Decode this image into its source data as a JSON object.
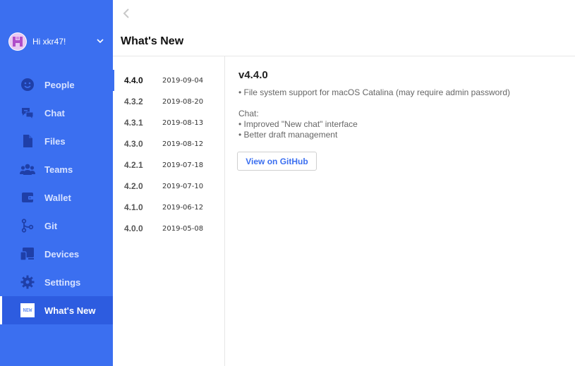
{
  "user": {
    "greeting": "Hi xkr47!"
  },
  "nav": {
    "items": [
      {
        "label": "People",
        "icon": "smiley-icon"
      },
      {
        "label": "Chat",
        "icon": "chat-bubbles-icon"
      },
      {
        "label": "Files",
        "icon": "file-icon"
      },
      {
        "label": "Teams",
        "icon": "team-icon"
      },
      {
        "label": "Wallet",
        "icon": "wallet-icon"
      },
      {
        "label": "Git",
        "icon": "git-branch-icon"
      },
      {
        "label": "Devices",
        "icon": "devices-icon"
      },
      {
        "label": "Settings",
        "icon": "gear-icon"
      },
      {
        "label": "What's New",
        "icon": "new-badge-icon",
        "badge": "NEW",
        "active": true
      }
    ]
  },
  "header": {
    "title": "What's New"
  },
  "versions": [
    {
      "version": "4.4.0",
      "date": "2019-09-04",
      "active": true
    },
    {
      "version": "4.3.2",
      "date": "2019-08-20"
    },
    {
      "version": "4.3.1",
      "date": "2019-08-13"
    },
    {
      "version": "4.3.0",
      "date": "2019-08-12"
    },
    {
      "version": "4.2.1",
      "date": "2019-07-18"
    },
    {
      "version": "4.2.0",
      "date": "2019-07-10"
    },
    {
      "version": "4.1.0",
      "date": "2019-06-12"
    },
    {
      "version": "4.0.0",
      "date": "2019-05-08"
    }
  ],
  "detail": {
    "title": "v4.4.0",
    "lines": [
      "• File system support for macOS Catalina (may require admin password)",
      "",
      "Chat:",
      "• Improved \"New chat\" interface",
      "• Better draft management"
    ],
    "github_button": "View on GitHub"
  },
  "colors": {
    "accent": "#3b6ff0",
    "sidebar_active": "#2d5ce0",
    "nav_icon": "#1f3fa8"
  }
}
